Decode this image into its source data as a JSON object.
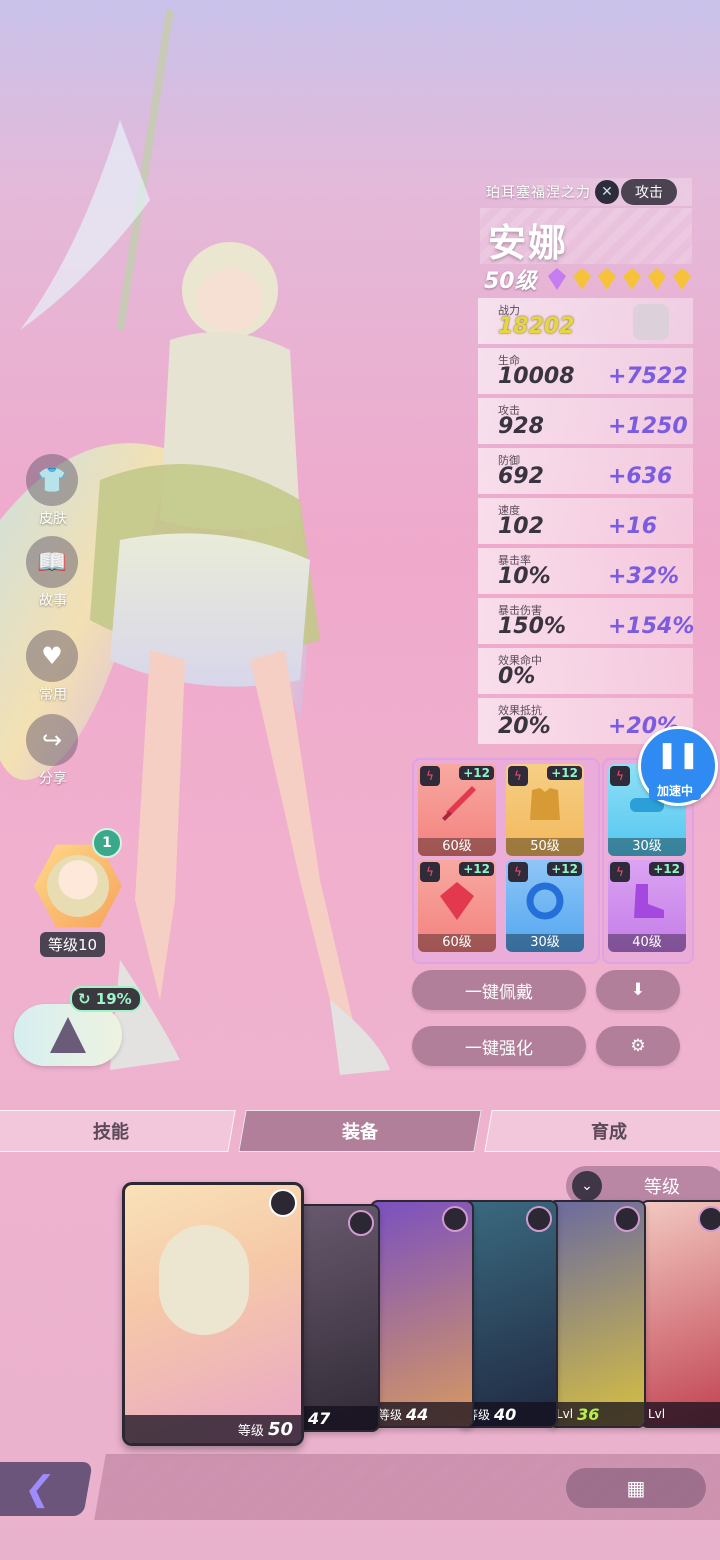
{
  "header": {
    "faction": "珀耳塞福涅之力",
    "role": "攻击",
    "name": "安娜",
    "level": "50级",
    "stars": 6
  },
  "stats": [
    {
      "label": "战力",
      "value": "18202",
      "bonus": ""
    },
    {
      "label": "生命",
      "value": "10008",
      "bonus": "+7522"
    },
    {
      "label": "攻击",
      "value": "928",
      "bonus": "+1250"
    },
    {
      "label": "防御",
      "value": "692",
      "bonus": "+636"
    },
    {
      "label": "速度",
      "value": "102",
      "bonus": "+16"
    },
    {
      "label": "暴击率",
      "value": "10%",
      "bonus": "+32%"
    },
    {
      "label": "暴击伤害",
      "value": "150%",
      "bonus": "+154%"
    },
    {
      "label": "效果命中",
      "value": "0%",
      "bonus": ""
    },
    {
      "label": "效果抵抗",
      "value": "20%",
      "bonus": "+20%"
    }
  ],
  "side_menu": [
    {
      "label": "皮肤",
      "icon": "shirt-icon"
    },
    {
      "label": "故事",
      "icon": "book-icon"
    },
    {
      "label": "常用",
      "icon": "heart-icon"
    },
    {
      "label": "分享",
      "icon": "share-icon"
    }
  ],
  "avatar": {
    "rank": "1",
    "level": "等级10"
  },
  "boost": "19%",
  "equipment": [
    {
      "plus": "+12",
      "level": "60级",
      "item": "sword",
      "color": "#f4817e"
    },
    {
      "plus": "+12",
      "level": "50级",
      "item": "armor",
      "color": "#f2b85c"
    },
    {
      "plus": "",
      "level": "30级",
      "item": "goggles",
      "color": "#53c6ef"
    },
    {
      "plus": "+12",
      "level": "60级",
      "item": "ring",
      "color": "#f4817e"
    },
    {
      "plus": "+12",
      "level": "30级",
      "item": "necklace",
      "color": "#53a6ef"
    },
    {
      "plus": "+12",
      "level": "40级",
      "item": "boots",
      "color": "#c47ce8"
    }
  ],
  "actions": {
    "equip_all": "一键佩戴",
    "enhance_all": "一键强化"
  },
  "pause": {
    "label": "加速中"
  },
  "tabs": [
    "技能",
    "装备",
    "育成"
  ],
  "sort": {
    "label": "等级"
  },
  "heroes": [
    {
      "lv_label": "等级",
      "lv": "50"
    },
    {
      "lv_label": "等级",
      "lv": "47"
    },
    {
      "lv_label": "等级",
      "lv": "44"
    },
    {
      "lv_label": "等级",
      "lv": "40"
    },
    {
      "lv_label": "Lvl",
      "lv": "36"
    },
    {
      "lv_label": "Lvl",
      "lv": ""
    }
  ],
  "colors": {
    "accent": "#b27f9a",
    "bonus": "#7b5ce0",
    "pause": "#2f8bf2"
  }
}
